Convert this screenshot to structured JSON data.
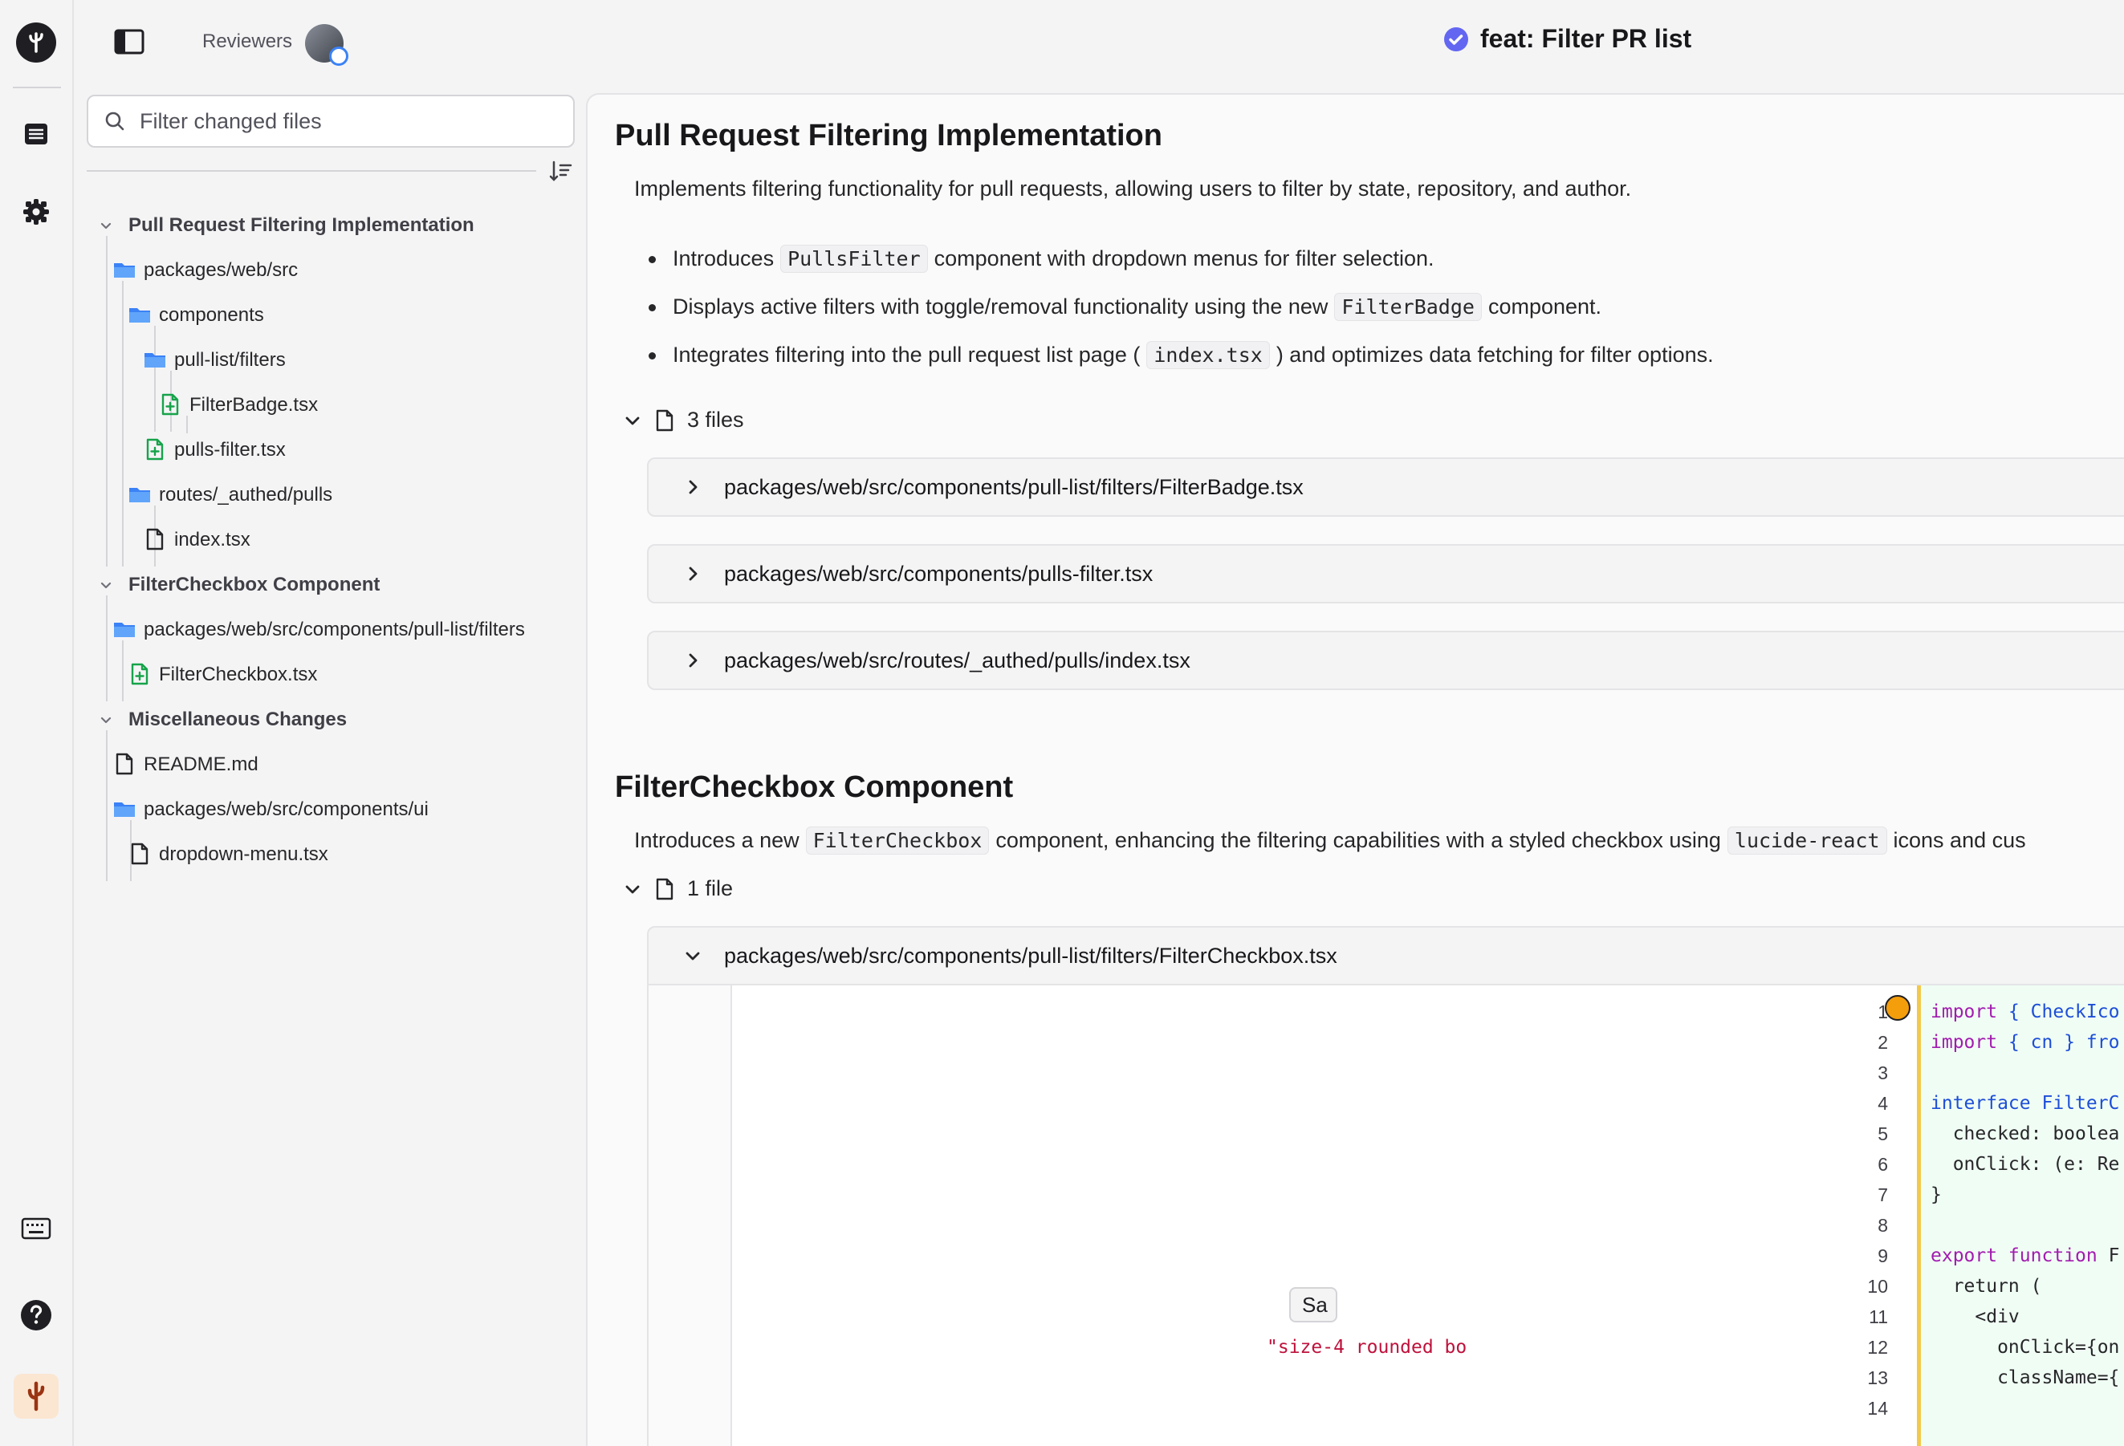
{
  "rail": {
    "icons": [
      "app-logo-icon",
      "list-icon",
      "gear-icon",
      "keyboard-icon",
      "help-icon",
      "cactus-icon"
    ]
  },
  "header": {
    "reviewers_label": "Reviewers",
    "pr_title": "feat: Filter PR list",
    "status_color": "#6366f1"
  },
  "sidebar": {
    "filter_placeholder": "Filter changed files",
    "tree": [
      {
        "label": "Pull Request Filtering Implementation",
        "type": "group"
      },
      {
        "label": "packages/web/src",
        "type": "folder"
      },
      {
        "label": "components",
        "type": "folder"
      },
      {
        "label": "pull-list/filters",
        "type": "folder"
      },
      {
        "label": "FilterBadge.tsx",
        "type": "file-added"
      },
      {
        "label": "pulls-filter.tsx",
        "type": "file-added"
      },
      {
        "label": "routes/_authed/pulls",
        "type": "folder"
      },
      {
        "label": "index.tsx",
        "type": "file"
      },
      {
        "label": "FilterCheckbox Component",
        "type": "group"
      },
      {
        "label": "packages/web/src/components/pull-list/filters",
        "type": "folder"
      },
      {
        "label": "FilterCheckbox.tsx",
        "type": "file-added"
      },
      {
        "label": "Miscellaneous Changes",
        "type": "group"
      },
      {
        "label": "README.md",
        "type": "file"
      },
      {
        "label": "packages/web/src/components/ui",
        "type": "folder"
      },
      {
        "label": "dropdown-menu.tsx",
        "type": "file"
      }
    ]
  },
  "main": {
    "section1": {
      "title": "Pull Request Filtering Implementation",
      "desc": "Implements filtering functionality for pull requests, allowing users to filter by state, repository, and author.",
      "bullet1_pre": "Introduces",
      "bullet1_code": "PullsFilter",
      "bullet1_post": "component with dropdown menus for filter selection.",
      "bullet2_pre": "Displays active filters with toggle/removal functionality using the new",
      "bullet2_code": "FilterBadge",
      "bullet2_post": "component.",
      "bullet3_pre": "Integrates filtering into the pull request list page (",
      "bullet3_code": "index.tsx",
      "bullet3_post": ") and optimizes data fetching for filter options.",
      "files_count": "3 files",
      "files": [
        "packages/web/src/components/pull-list/filters/FilterBadge.tsx",
        "packages/web/src/components/pulls-filter.tsx",
        "packages/web/src/routes/_authed/pulls/index.tsx"
      ]
    },
    "section2": {
      "title": "FilterCheckbox Component",
      "desc_pre": "Introduces a new",
      "desc_code1": "FilterCheckbox",
      "desc_mid": "component, enhancing the filtering capabilities with a styled checkbox using",
      "desc_code2": "lucide-react",
      "desc_post": "icons and cus",
      "files_count": "1 file",
      "file": "packages/web/src/components/pull-list/filters/FilterCheckbox.tsx"
    },
    "diff": {
      "line_numbers": [
        "1",
        "2",
        "3",
        "4",
        "5",
        "6",
        "7",
        "8",
        "9",
        "10",
        "11",
        "12",
        "13",
        "14"
      ],
      "lines": [
        [
          "import",
          " { CheckIco"
        ],
        [
          "import",
          " { cn } fro"
        ],
        [
          "",
          ""
        ],
        [
          "interface",
          " FilterC"
        ],
        [
          "",
          "  checked: boolea"
        ],
        [
          "",
          "  onClick: (e: Re"
        ],
        [
          "",
          "}"
        ],
        [
          "",
          ""
        ],
        [
          "export function",
          " F"
        ],
        [
          "",
          "  return ("
        ],
        [
          "",
          "    <div"
        ],
        [
          "",
          "      onClick={on"
        ],
        [
          "",
          "      className={"
        ],
        [
          "",
          ""
        ]
      ],
      "button_label": "Sa",
      "trailing_string": "\"size-4 rounded bo"
    }
  }
}
